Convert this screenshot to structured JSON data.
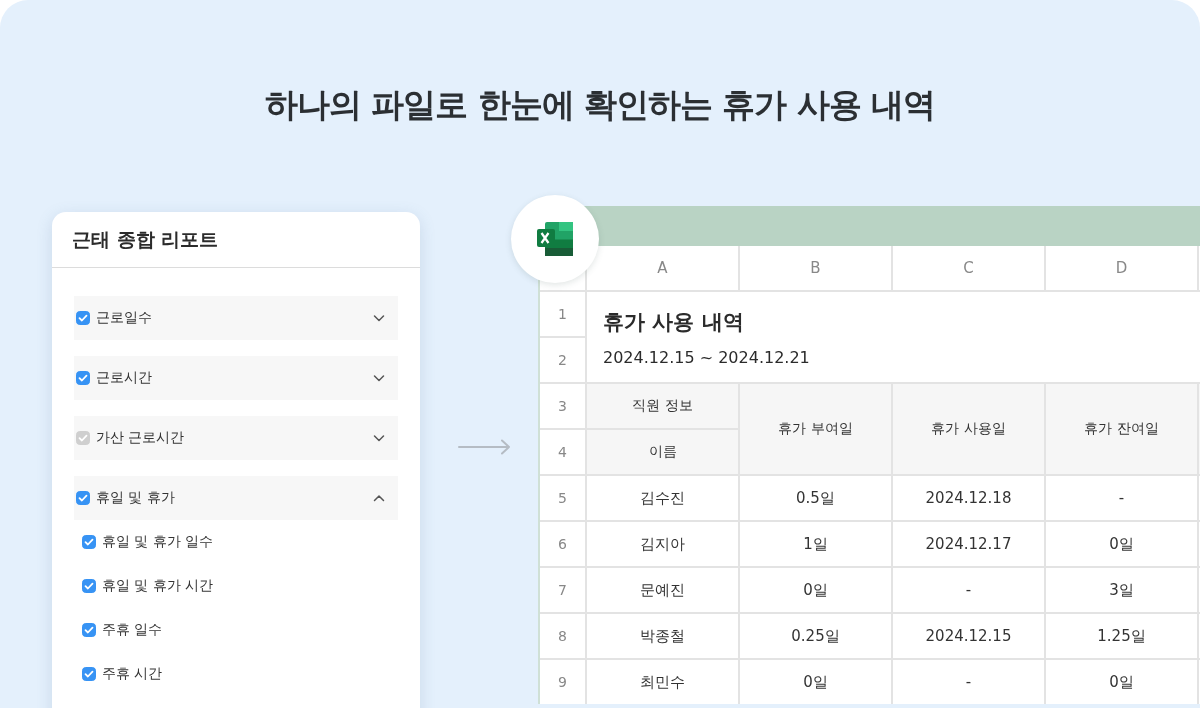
{
  "headline": "하나의 파일로 한눈에 확인하는 휴가 사용 내역",
  "report_panel": {
    "title": "근태 종합 리포트",
    "sections": [
      {
        "label": "근로일수",
        "checked": true,
        "disabled": false,
        "expanded": false
      },
      {
        "label": "근로시간",
        "checked": true,
        "disabled": false,
        "expanded": false
      },
      {
        "label": "가산 근로시간",
        "checked": true,
        "disabled": true,
        "expanded": false
      },
      {
        "label": "휴일 및 휴가",
        "checked": true,
        "disabled": false,
        "expanded": true,
        "children": [
          {
            "label": "휴일 및 휴가 일수",
            "checked": true
          },
          {
            "label": "휴일 및 휴가 시간",
            "checked": true
          },
          {
            "label": "주휴 일수",
            "checked": true
          },
          {
            "label": "주휴 시간",
            "checked": true
          }
        ]
      }
    ]
  },
  "spreadsheet": {
    "columns": [
      "A",
      "B",
      "C",
      "D"
    ],
    "row_numbers": [
      "1",
      "2",
      "3",
      "4",
      "5",
      "6",
      "7",
      "8",
      "9"
    ],
    "title": "휴가 사용 내역",
    "date_range": "2024.12.15 ~ 2024.12.21",
    "header": {
      "group": "직원 정보",
      "name": "이름",
      "granted": "휴가 부여일",
      "used": "휴가 사용일",
      "remaining": "휴가 잔여일"
    },
    "rows": [
      [
        "김수진",
        "0.5일",
        "2024.12.18",
        "-"
      ],
      [
        "김지아",
        "1일",
        "2024.12.17",
        "0일"
      ],
      [
        "문예진",
        "0일",
        "-",
        "3일"
      ],
      [
        "박종철",
        "0.25일",
        "2024.12.15",
        "1.25일"
      ],
      [
        "최민수",
        "0일",
        "-",
        "0일"
      ]
    ]
  }
}
